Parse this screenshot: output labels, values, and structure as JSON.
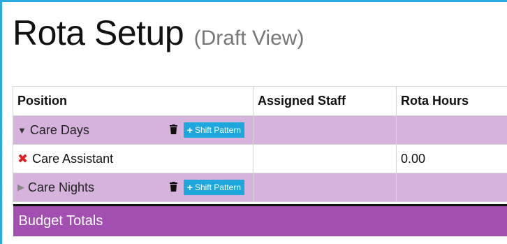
{
  "page": {
    "title": "Rota Setup",
    "subtitle": "(Draft View)"
  },
  "table": {
    "headers": [
      "Position",
      "Assigned Staff",
      "Rota Hours"
    ],
    "rows": [
      {
        "type": "group",
        "label": "Care Days",
        "expanded": true,
        "button": "Shift Pattern"
      },
      {
        "type": "item",
        "label": "Care Assistant",
        "staff": "",
        "hours": "0.00"
      },
      {
        "type": "group",
        "label": "Care Nights",
        "expanded": false,
        "button": "Shift Pattern"
      }
    ],
    "budget_label": "Budget Totals"
  },
  "colors": {
    "accent_border": "#29abe2",
    "group_row_bg": "#d5b3dc",
    "budget_bg": "#a34fb2",
    "button_bg": "#1ea7dc",
    "remove_icon": "#e02020"
  },
  "icons": [
    "expand-triangle-icon",
    "collapse-triangle-icon",
    "trash-icon",
    "plus-icon",
    "remove-x-icon"
  ]
}
